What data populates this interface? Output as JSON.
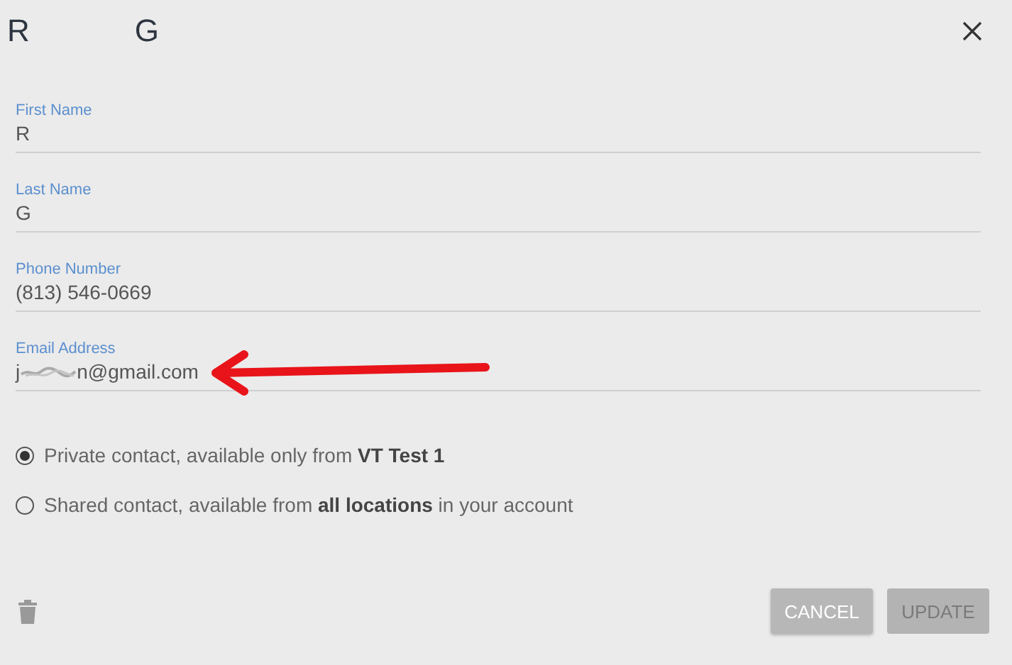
{
  "title": {
    "first": "R",
    "last": "G"
  },
  "fields": [
    {
      "label": "First Name",
      "value": "R"
    },
    {
      "label": "Last Name",
      "value": "G"
    },
    {
      "label": "Phone Number",
      "value": "(813) 546-0669"
    },
    {
      "label": "Email Address",
      "value_start": "j",
      "value_end": "n@gmail.com",
      "redacted": true
    }
  ],
  "sharing": [
    {
      "text": "Private contact, available only from **VT Test 1**",
      "selected": true
    },
    {
      "text": "Shared contact, available from **all locations** in your account",
      "selected": false
    }
  ],
  "buttons": [
    {
      "label": "CANCEL",
      "disabled": false
    },
    {
      "label": "UPDATE",
      "disabled": true
    }
  ]
}
